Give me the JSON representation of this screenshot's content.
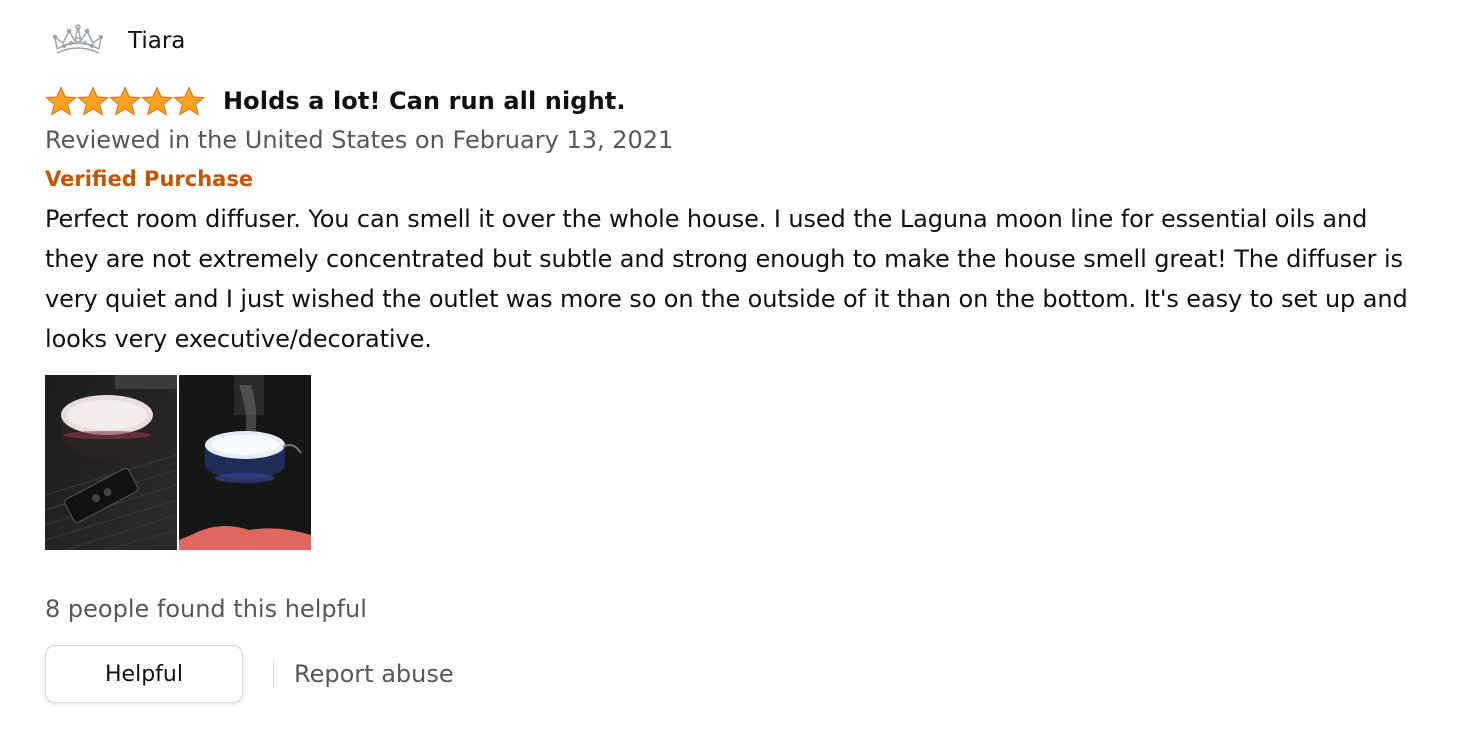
{
  "profile": {
    "name": "Tiara",
    "avatar_icon": "tiara-crown-icon"
  },
  "review": {
    "rating": 5,
    "rating_max": 5,
    "star_color": "#ffa41c",
    "title": "Holds a lot! Can run all night.",
    "date_text": "Reviewed in the United States on February 13, 2021",
    "verified_label": "Verified Purchase",
    "verified_color": "#c45500",
    "body": "Perfect room diffuser. You can smell it over the whole house. I used the Laguna moon line for essential oils and they are not extremely concentrated but subtle and strong enough to make the house smell great! The diffuser is very quiet and I just wished the outlet was more so on the outside of it than on the bottom. It's easy to set up and looks very executive/decorative.",
    "images": [
      {
        "name": "review-image-1",
        "description_icon": "diffuser-photo"
      },
      {
        "name": "review-image-2",
        "description_icon": "diffuser-photo"
      }
    ]
  },
  "footer": {
    "helpful_count_text": "8 people found this helpful",
    "helpful_button_label": "Helpful",
    "report_label": "Report abuse"
  }
}
